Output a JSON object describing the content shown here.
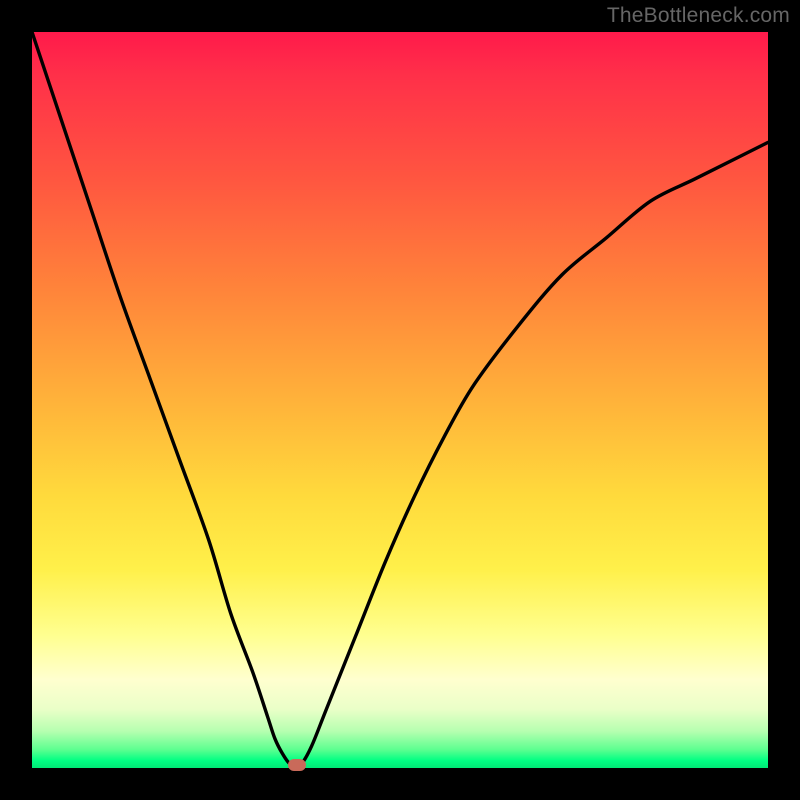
{
  "watermark": "TheBottleneck.com",
  "chart_data": {
    "type": "line",
    "title": "",
    "xlabel": "",
    "ylabel": "",
    "xlim": [
      0,
      100
    ],
    "ylim": [
      0,
      100
    ],
    "grid": false,
    "series": [
      {
        "name": "curve",
        "x": [
          0,
          4,
          8,
          12,
          16,
          20,
          24,
          27,
          30,
          32,
          33,
          34,
          35,
          36,
          36.6,
          38,
          40,
          44,
          48,
          52,
          56,
          60,
          66,
          72,
          78,
          84,
          90,
          96,
          100
        ],
        "values": [
          100,
          88,
          76,
          64,
          53,
          42,
          31,
          21,
          13,
          7,
          4,
          2,
          0.6,
          0.4,
          0.5,
          3,
          8,
          18,
          28,
          37,
          45,
          52,
          60,
          67,
          72,
          77,
          80,
          83,
          85
        ]
      }
    ],
    "marker": {
      "x": 36,
      "y": 0.4,
      "color": "#c96a5a"
    },
    "gradient_stops": [
      {
        "pos": 0,
        "color": "#ff1a4b"
      },
      {
        "pos": 0.5,
        "color": "#ffb23a"
      },
      {
        "pos": 0.75,
        "color": "#fff04a"
      },
      {
        "pos": 0.94,
        "color": "#b6ffb0"
      },
      {
        "pos": 1.0,
        "color": "#00e876"
      }
    ]
  }
}
